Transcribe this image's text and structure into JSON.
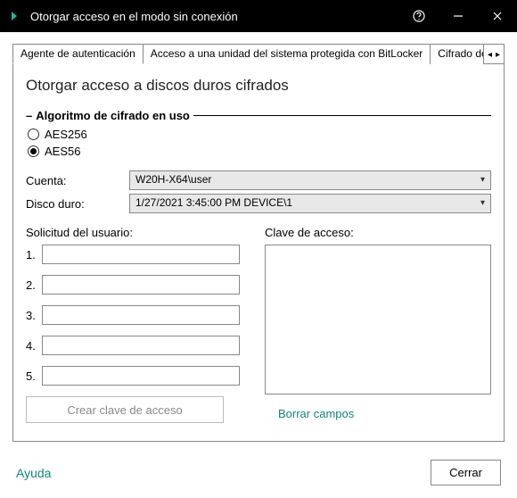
{
  "window": {
    "title": "Otorgar acceso en el modo sin conexión"
  },
  "tabs": {
    "t1": "Agente de autenticación",
    "t2": "Acceso a una unidad del sistema protegida con BitLocker",
    "t3": "Cifrado de dat"
  },
  "heading": "Otorgar acceso a discos duros cifrados",
  "group": {
    "title": "Algoritmo de cifrado en uso",
    "dash": "–"
  },
  "radios": {
    "r1": "AES256",
    "r2": "AES56",
    "selected": "AES56"
  },
  "fields": {
    "account_label": "Cuenta:",
    "account_value": "W20H-X64\\user",
    "disk_label": "Disco duro:",
    "disk_value": "1/27/2021 3:45:00 PM  DEVICE\\1"
  },
  "request": {
    "label": "Solicitud del usuario:",
    "nums": {
      "n1": "1.",
      "n2": "2.",
      "n3": "3.",
      "n4": "4.",
      "n5": "5."
    }
  },
  "key": {
    "label": "Clave de acceso:"
  },
  "buttons": {
    "create": "Crear clave de acceso",
    "clear": "Borrar campos",
    "close": "Cerrar"
  },
  "footer": {
    "help": "Ayuda"
  },
  "scroll": {
    "left": "◂",
    "right": "▸"
  }
}
